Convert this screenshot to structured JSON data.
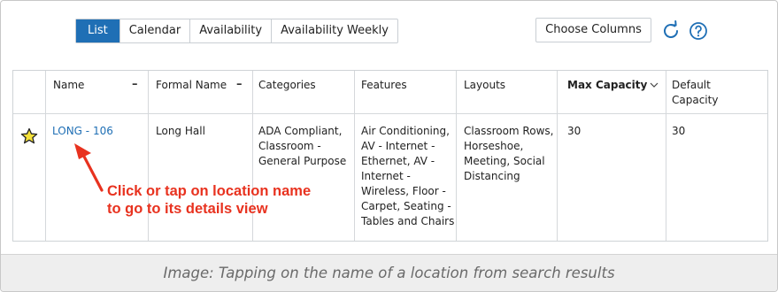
{
  "toolbar": {
    "tabs": [
      {
        "label": "List",
        "active": true
      },
      {
        "label": "Calendar",
        "active": false
      },
      {
        "label": "Availability",
        "active": false
      },
      {
        "label": "Availability Weekly",
        "active": false
      }
    ],
    "choose_columns_label": "Choose Columns",
    "refresh_icon": "refresh-icon",
    "help_icon": "help-icon"
  },
  "table": {
    "headers": {
      "name": "Name",
      "formal_name": "Formal Name",
      "categories": "Categories",
      "features": "Features",
      "layouts": "Layouts",
      "max_capacity": "Max Capacity",
      "default_capacity_line1": "Default",
      "default_capacity_line2": "Capacity"
    },
    "sort_indicator": "–",
    "rows": [
      {
        "favorite_icon": "star-icon",
        "name": "LONG - 106",
        "formal_name": "Long Hall",
        "categories": [
          "ADA Compliant,",
          "Classroom -",
          "General Purpose"
        ],
        "features": [
          "Air Conditioning,",
          "AV - Internet -",
          "Ethernet, AV -",
          "Internet -",
          "Wireless, Floor -",
          "Carpet, Seating -",
          "Tables and Chairs"
        ],
        "layouts": [
          "Classroom Rows,",
          "Horseshoe,",
          "Meeting, Social",
          "Distancing"
        ],
        "max_capacity": "30",
        "default_capacity": "30"
      }
    ]
  },
  "annotation": {
    "line1": "Click or tap on location name",
    "line2": "to go to its details view",
    "color": "#e8321f"
  },
  "caption": "Image: Tapping on the name of a location from search results",
  "colors": {
    "accent": "#1f6fb5",
    "annotation": "#e8321f",
    "caption_bg": "#eeeeee"
  }
}
